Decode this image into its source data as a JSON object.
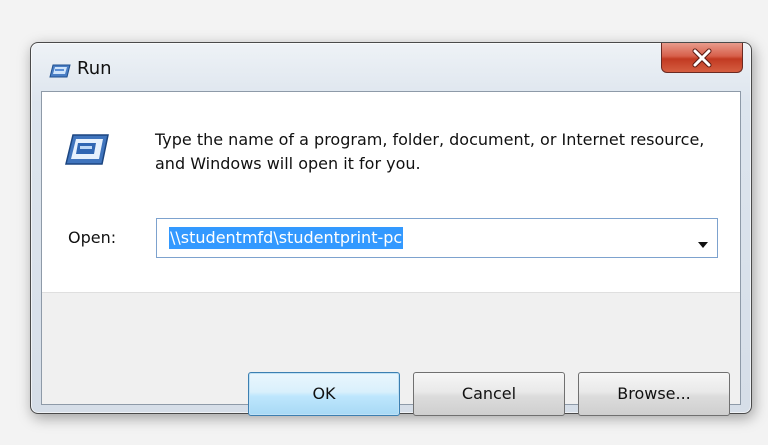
{
  "window": {
    "title": "Run",
    "title_icon": "run-icon",
    "close_icon": "close-icon"
  },
  "dialog": {
    "icon": "run-large-icon",
    "message": "Type the name of a program, folder, document, or Internet resource, and Windows will open it for you.",
    "open_label": "Open:",
    "open_value": "\\\\studentmfd\\studentprint-pc",
    "dropdown_icon": "dropdown-arrow-icon"
  },
  "buttons": {
    "ok": "OK",
    "cancel": "Cancel",
    "browse": "Browse..."
  }
}
